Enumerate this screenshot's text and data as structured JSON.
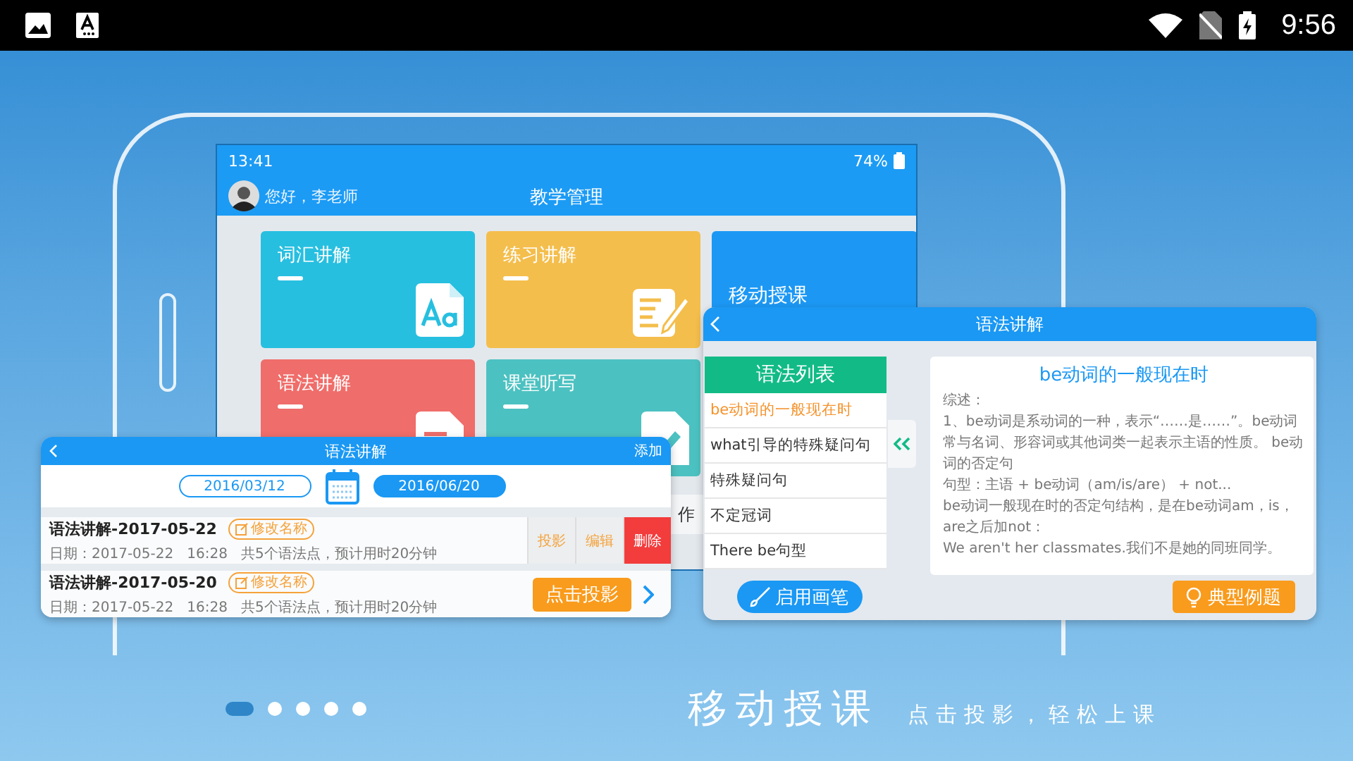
{
  "status_bar": {
    "time": "9:56"
  },
  "tablet": {
    "time": "13:41",
    "battery": "74%",
    "greeting": "您好，李老师",
    "title": "教学管理",
    "tiles": [
      {
        "label": "词汇讲解",
        "color": "#27bfe0",
        "kind": "letters"
      },
      {
        "label": "练习讲解",
        "color": "#f4be4c",
        "kind": "note"
      },
      {
        "label": "移动授课",
        "color": "#1c98f4",
        "kind": "none"
      },
      {
        "label": "语法讲解",
        "color": "#ef6d6a",
        "kind": "doc"
      },
      {
        "label": "课堂听写",
        "color": "#4cc1c1",
        "kind": "pen"
      }
    ],
    "bottom_label": "作"
  },
  "list_card": {
    "title": "语法讲解",
    "action": "添加",
    "dates": [
      {
        "text": "2016/03/12",
        "selected": false
      },
      {
        "text": "2016/06/20",
        "selected": true
      }
    ],
    "records": [
      {
        "kind": "swiped",
        "title": "语法讲解-2017-05-22",
        "rename": "修改名称",
        "meta": "日期：2017-05-22   16:28   共5个语法点，预计用时20分钟",
        "actions": [
          {
            "label": "投影",
            "kind": "normal"
          },
          {
            "label": "编辑",
            "kind": "normal"
          },
          {
            "label": "删除",
            "kind": "danger"
          }
        ]
      },
      {
        "kind": "normal",
        "title": "语法讲解-2017-05-20",
        "rename": "修改名称",
        "meta": "日期：2017-05-22   16:28   共5个语法点，预计用时20分钟",
        "button": "点击投影"
      }
    ]
  },
  "grammar_card": {
    "title": "语法讲解",
    "list_title": "语法列表",
    "items": [
      {
        "label": "be动词的一般现在时",
        "selected": true
      },
      {
        "label": "what引导的特殊疑问句",
        "selected": false
      },
      {
        "label": "特殊疑问句",
        "selected": false
      },
      {
        "label": "不定冠词",
        "selected": false
      },
      {
        "label": "There be句型",
        "selected": false
      }
    ],
    "detail": {
      "title": "be动词的一般现在时",
      "paragraphs": [
        "综述：",
        "1、be动词是系动词的一种，表示“……是……”。be动词常与名词、形容词或其他词类一起表示主语的性质。 be动词的否定句",
        "句型：主语 + be动词（am/is/are） + not...",
        "be动词一般现在时的否定句结构，是在be动词am，is，are之后加not：",
        "We aren't her classmates.我们不是她的同班同学。"
      ]
    },
    "pen_button": "启用画笔",
    "example_button": "典型例题"
  },
  "footer": {
    "pages": [
      {
        "selected": true
      },
      {
        "selected": false
      },
      {
        "selected": false
      },
      {
        "selected": false
      },
      {
        "selected": false
      }
    ],
    "headline": "移动授课",
    "tagline": "点击投影，轻松上课"
  }
}
